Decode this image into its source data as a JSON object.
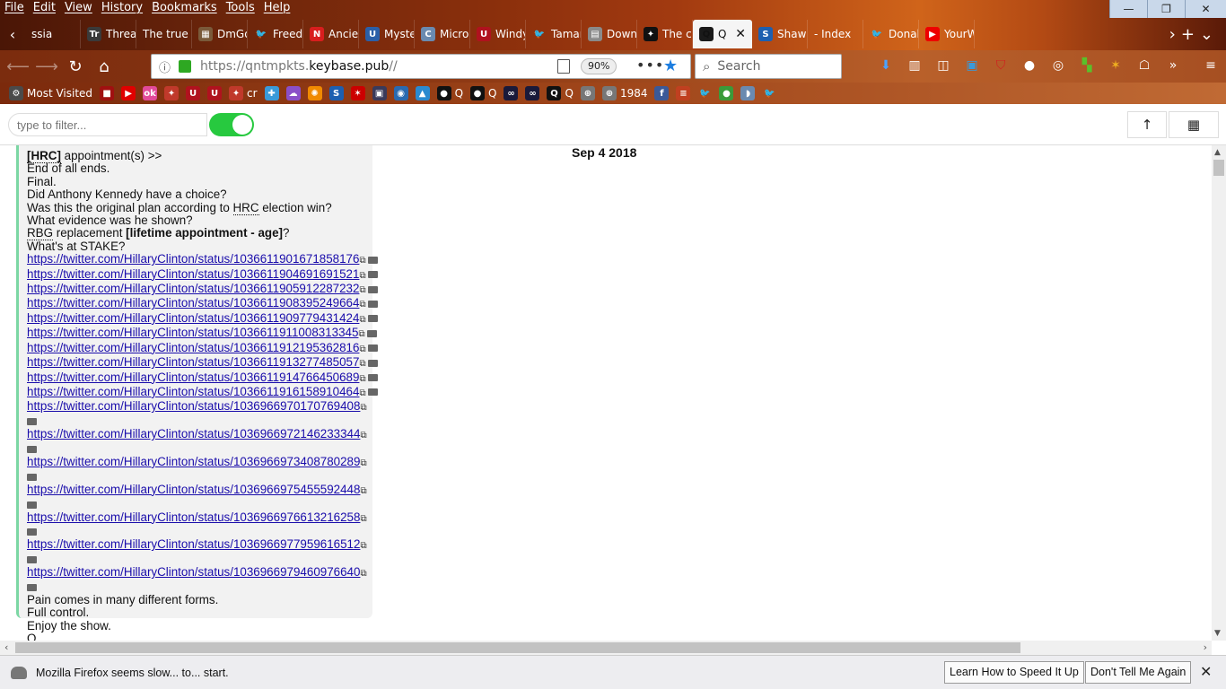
{
  "menu": [
    "File",
    "Edit",
    "View",
    "History",
    "Bookmarks",
    "Tools",
    "Help"
  ],
  "window_controls": {
    "minimize": "—",
    "maximize": "❐",
    "close": "✕"
  },
  "tabs": [
    {
      "label": "ssia",
      "icon": "",
      "color": "transparent"
    },
    {
      "label": "Threa",
      "icon": "Tr",
      "color": "#3a3a3a"
    },
    {
      "label": "The true st",
      "icon": "",
      "color": "transparent"
    },
    {
      "label": "DmGo",
      "icon": "▦",
      "color": "#7a5a3a"
    },
    {
      "label": "Freedo",
      "icon": "🐦",
      "color": "transparent"
    },
    {
      "label": "Ancie",
      "icon": "N",
      "color": "#d81e1e"
    },
    {
      "label": "Myste",
      "icon": "U",
      "color": "#2b5fa8"
    },
    {
      "label": "Micro",
      "icon": "C",
      "color": "#6a8ab0"
    },
    {
      "label": "Windy",
      "icon": "U",
      "color": "#b0121e"
    },
    {
      "label": "Tamar",
      "icon": "🐦",
      "color": "transparent"
    },
    {
      "label": "Downl",
      "icon": "▤",
      "color": "#8a8a8a"
    },
    {
      "label": "The co",
      "icon": "✦",
      "color": "#111"
    },
    {
      "label": "Q",
      "icon": "Q",
      "color": "#1a1a1a",
      "active": true
    },
    {
      "label": "Shaw",
      "icon": "S",
      "color": "#1d5fb0"
    },
    {
      "label": "- Index",
      "icon": "",
      "color": "transparent"
    },
    {
      "label": "Donal",
      "icon": "🐦",
      "color": "transparent"
    },
    {
      "label": "YourW",
      "icon": "▶",
      "color": "#e00"
    }
  ],
  "nav": {
    "url_prefix": "https://qntmpkts.",
    "url_domain": "keybase.pub",
    "url_suffix": "//",
    "zoom": "90%",
    "search_placeholder": "Search"
  },
  "bookmarks": [
    {
      "label": "Most Visited",
      "icon": "⚙",
      "color": "#4a4a4a"
    },
    {
      "label": "",
      "icon": "■",
      "color": "#a01010"
    },
    {
      "label": "",
      "icon": "▶",
      "color": "#e00000"
    },
    {
      "label": "",
      "icon": "ok",
      "color": "#e24a9a"
    },
    {
      "label": "",
      "icon": "✦",
      "color": "#c0392b"
    },
    {
      "label": "",
      "icon": "U",
      "color": "#b0121e"
    },
    {
      "label": "",
      "icon": "U",
      "color": "#b0121e"
    },
    {
      "label": "cr",
      "icon": "✦",
      "color": "#c0392b"
    },
    {
      "label": "",
      "icon": "✚",
      "color": "#3a9ad9"
    },
    {
      "label": "",
      "icon": "☁",
      "color": "#8a4fc8"
    },
    {
      "label": "",
      "icon": "✺",
      "color": "#f08a00"
    },
    {
      "label": "",
      "icon": "S",
      "color": "#1d5fb0"
    },
    {
      "label": "",
      "icon": "✶",
      "color": "#c00"
    },
    {
      "label": "",
      "icon": "▣",
      "color": "#3a3a5a"
    },
    {
      "label": "",
      "icon": "◉",
      "color": "#2a6ab0"
    },
    {
      "label": "",
      "icon": "▲",
      "color": "#2a8ad0"
    },
    {
      "label": "Q",
      "icon": "●",
      "color": "#111"
    },
    {
      "label": "Q",
      "icon": "●",
      "color": "#111"
    },
    {
      "label": "",
      "icon": "∞",
      "color": "#1a1a3a"
    },
    {
      "label": "",
      "icon": "∞",
      "color": "#1a1a3a"
    },
    {
      "label": "Q",
      "icon": "Q",
      "color": "#111"
    },
    {
      "label": "",
      "icon": "⊕",
      "color": "#777"
    },
    {
      "label": "1984",
      "icon": "⊕",
      "color": "#777"
    },
    {
      "label": "",
      "icon": "f",
      "color": "#3b5998"
    },
    {
      "label": "",
      "icon": "≡",
      "color": "#c04020"
    },
    {
      "label": "",
      "icon": "🐦",
      "color": "transparent"
    },
    {
      "label": "",
      "icon": "●",
      "color": "#3a9a3a"
    },
    {
      "label": "",
      "icon": "◗",
      "color": "#6a8ab0"
    },
    {
      "label": "",
      "icon": "🐦",
      "color": "transparent"
    }
  ],
  "filter": {
    "placeholder": "type to filter...",
    "up_label": "↑"
  },
  "post": {
    "date": "Sep 4 2018",
    "line_hrc_abbr": "[HRC]",
    "line_hrc_rest": " appointment(s) >>",
    "lines_top": [
      "End of all ends.",
      "Final.",
      "Did Anthony Kennedy have a choice?"
    ],
    "orig_plan_pre": "Was this the original plan according to ",
    "orig_plan_abbr": "HRC",
    "orig_plan_post": " election win?",
    "line_evidence": "What evidence was he shown?",
    "rbg_abbr": "RBG",
    "rbg_mid": " replacement ",
    "rbg_bold": "[lifetime appointment - age]",
    "rbg_end": "?",
    "line_stake": "What's at STAKE?",
    "links_group1": [
      "https://twitter.com/HillaryClinton/status/1036611901671858176",
      "https://twitter.com/HillaryClinton/status/1036611904691691521",
      "https://twitter.com/HillaryClinton/status/1036611905912287232",
      "https://twitter.com/HillaryClinton/status/1036611908395249664",
      "https://twitter.com/HillaryClinton/status/1036611909779431424",
      "https://twitter.com/HillaryClinton/status/1036611911008313345",
      "https://twitter.com/HillaryClinton/status/1036611912195362816",
      "https://twitter.com/HillaryClinton/status/1036611913277485057",
      "https://twitter.com/HillaryClinton/status/1036611914766450689",
      "https://twitter.com/HillaryClinton/status/1036611916158910464"
    ],
    "links_group2": [
      "https://twitter.com/HillaryClinton/status/1036966970170769408",
      "https://twitter.com/HillaryClinton/status/1036966972146233344",
      "https://twitter.com/HillaryClinton/status/1036966973408780289",
      "https://twitter.com/HillaryClinton/status/1036966975455592448",
      "https://twitter.com/HillaryClinton/status/1036966976613216258",
      "https://twitter.com/HillaryClinton/status/1036966977959616512",
      "https://twitter.com/HillaryClinton/status/1036966979460976640"
    ],
    "lines_bottom": [
      "Pain comes in many different forms.",
      "Full control.",
      "Enjoy the show.",
      "Q"
    ]
  },
  "notification": {
    "message": "Mozilla Firefox seems slow... to... start.",
    "learn_button": "Learn How to Speed It Up",
    "dismiss_button": "Don't Tell Me Again"
  },
  "colors": {
    "accent_green": "#27c93f",
    "post_border": "#7cd7a4",
    "link": "#1a0dab"
  }
}
